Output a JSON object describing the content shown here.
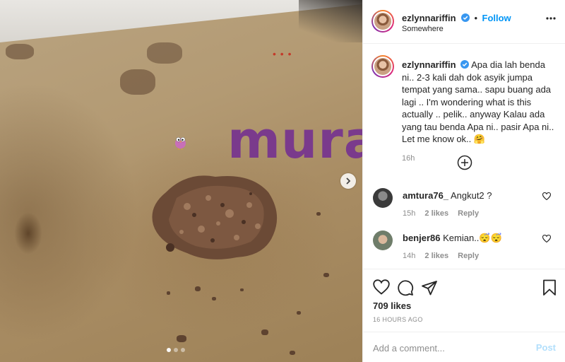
{
  "post": {
    "username": "ezlynnariffin",
    "follow_label": "Follow",
    "location": "Somewhere",
    "caption": "Apa dia lah benda ni.. 2-3 kali dah dok asyik jumpa tempat yang sama.. sapu buang ada lagi .. I'm wondering what is this actually .. pelik.. anyway Kalau ada yang tau benda Apa ni.. pasir Apa ni.. Let me know ok.. 🤗",
    "caption_time": "16h",
    "likes": "709 likes",
    "time_ago": "16 HOURS AGO"
  },
  "media": {
    "watermark": "murai",
    "red_dots": "• • •",
    "carousel_count": 3,
    "carousel_active": 0
  },
  "comments": [
    {
      "username": "amtura76_",
      "text": "Angkut2 ?",
      "time": "15h",
      "likes": "2 likes",
      "reply": "Reply"
    },
    {
      "username": "benjer86",
      "text": "Kemian..😴😴",
      "time": "14h",
      "likes": "2 likes",
      "reply": "Reply"
    }
  ],
  "composer": {
    "placeholder": "Add a comment...",
    "post_label": "Post"
  },
  "colors": {
    "accent": "#0095f6",
    "verified": "#3897f0",
    "watermark": "#7a3a8c"
  }
}
